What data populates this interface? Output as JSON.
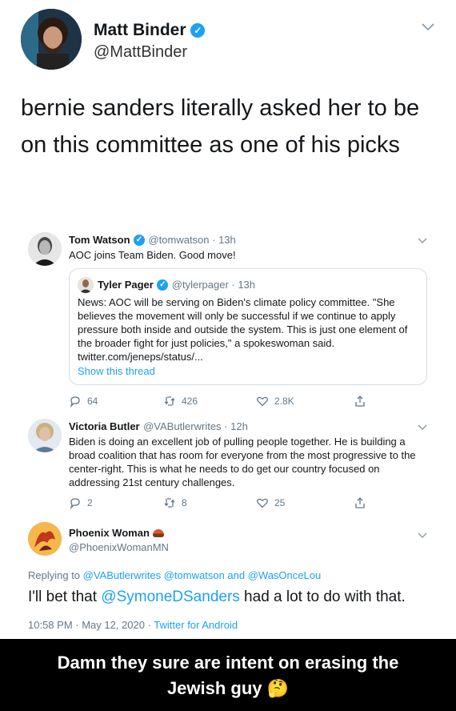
{
  "header": {
    "name": "Matt Binder",
    "handle": "@MattBinder",
    "text": "bernie sanders literally asked her to be on this committee as one of his picks"
  },
  "tweet1": {
    "name": "Tom Watson",
    "handle_time": "@tomwatson · 13h",
    "text": "AOC joins Team Biden. Good move!",
    "quote": {
      "name": "Tyler Pager",
      "handle_time": "@tylerpager · 13h",
      "text": "News: AOC will be serving on Biden's climate policy committee. \"She believes the movement will only be successful if we continue to apply pressure both inside and outside the system. This is just one element of the broader fight for just policies,\" a spokeswoman said. twitter.com/jeneps/status/...",
      "show_thread": "Show this thread"
    },
    "replies": "64",
    "retweets": "426",
    "likes": "2.8K"
  },
  "tweet2": {
    "name": "Victoria Butler",
    "handle_time": "@VAButlerwrites · 12h",
    "text": "Biden is doing an excellent job of pulling people together. He is building a broad coalition that has room for everyone from the most progressive to the center-right. This is what he needs to do get our country focused on addressing 21st century challenges.",
    "replies": "2",
    "retweets": "8",
    "likes": "25"
  },
  "tweet3": {
    "name": "Phoenix Woman",
    "handle": "@PhoenixWomanMN",
    "replying_prefix": "Replying to ",
    "replying_to": "@VAButlerwrites @tomwatson and @WasOnceLou",
    "text_before": "I'll bet that ",
    "mention": "@SymoneDSanders",
    "text_after": " had a lot to do with that.",
    "timestamp": "10:58 PM · May 12, 2020 · ",
    "client": "Twitter for Android"
  },
  "caption": "Damn they sure are intent on erasing the Jewish guy 🤔",
  "colors": {
    "accent": "#1da1f2",
    "muted": "#657786",
    "caption_bg": "#000000"
  }
}
